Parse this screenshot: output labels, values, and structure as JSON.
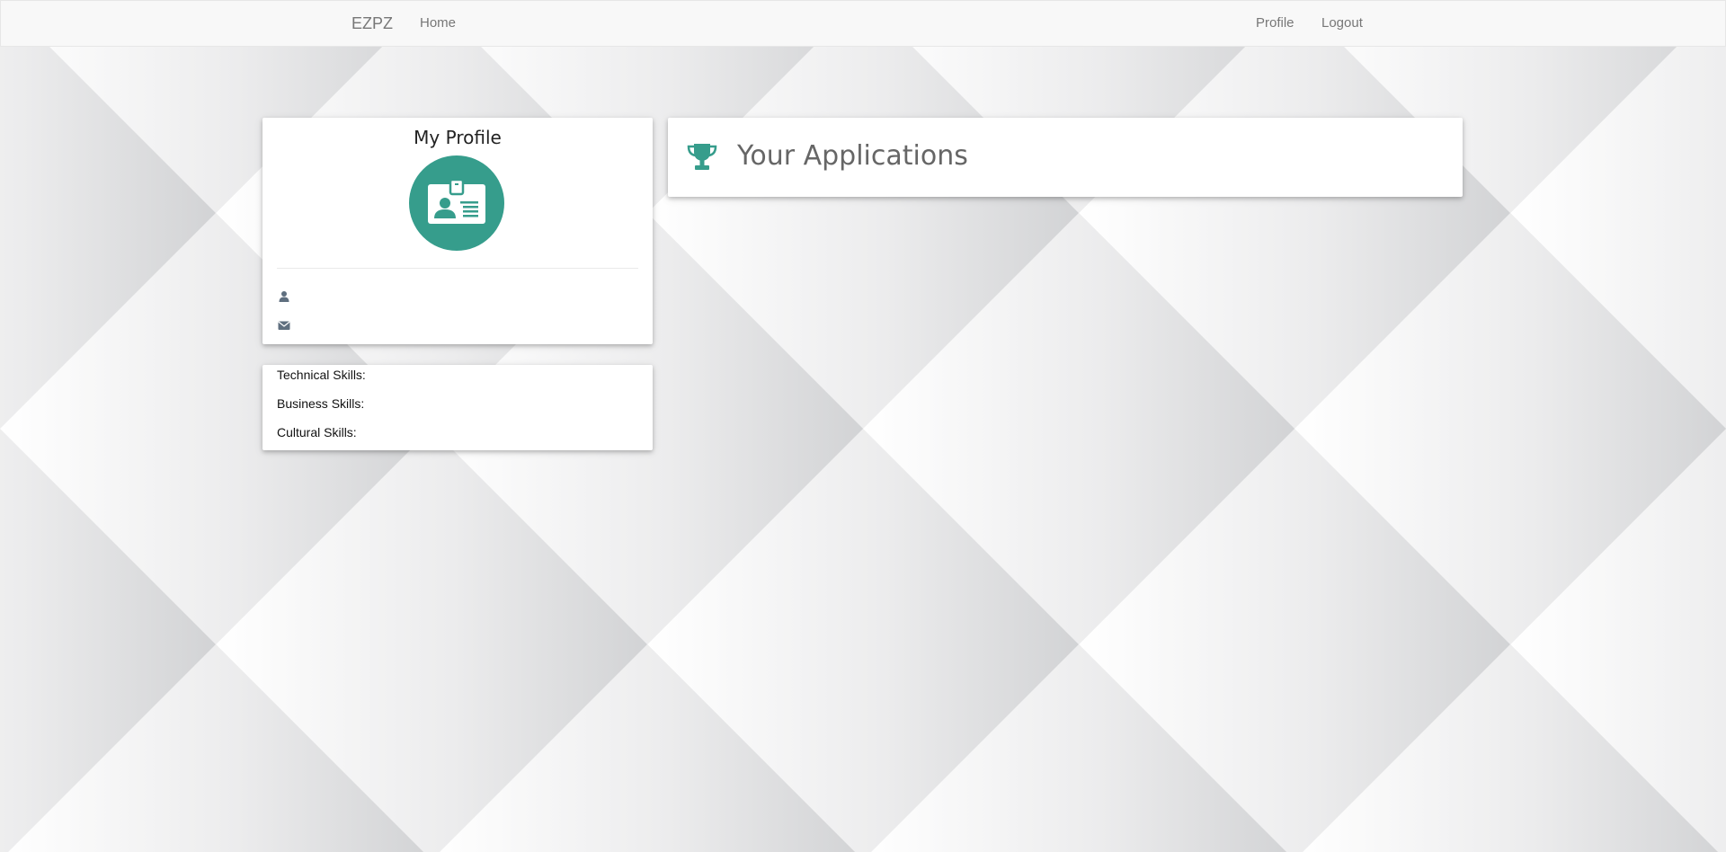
{
  "navbar": {
    "brand": "EZPZ",
    "home_label": "Home",
    "profile_label": "Profile",
    "logout_label": "Logout"
  },
  "profile": {
    "title": "My Profile",
    "avatar_icon": "id-card-icon",
    "username": "",
    "email": "",
    "user_icon": "user-icon",
    "email_icon": "envelope-icon"
  },
  "skills": {
    "technical_label": "Technical Skills:",
    "business_label": "Business Skills:",
    "cultural_label": "Cultural Skills:"
  },
  "applications": {
    "title": "Your Applications",
    "icon": "trophy-icon"
  },
  "colors": {
    "accent": "#369d8c",
    "navbar_bg": "#f8f8f8",
    "nav_text": "#777777",
    "icon_gray": "#5f6f7f"
  }
}
